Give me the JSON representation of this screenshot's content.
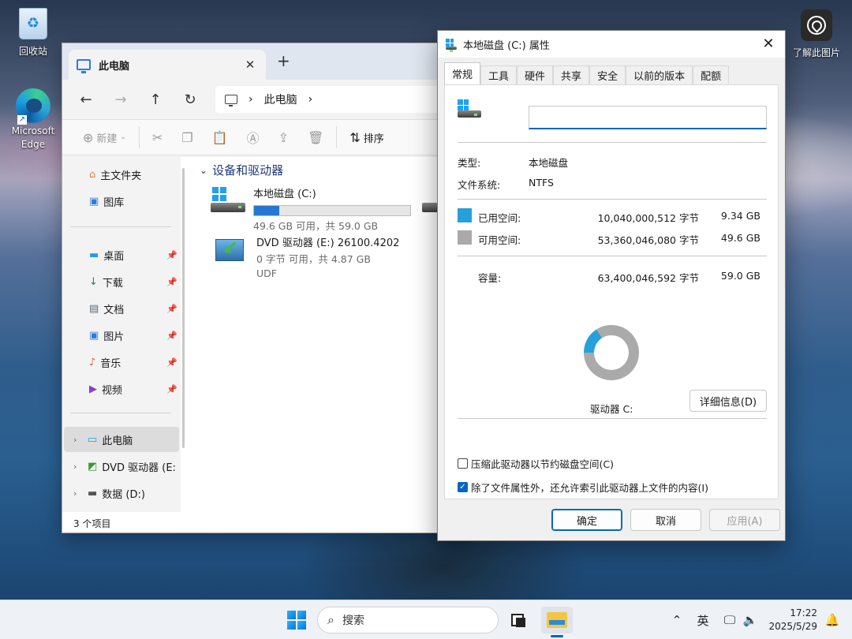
{
  "desktop": {
    "recycle_bin": "回收站",
    "edge": "Microsoft Edge",
    "about_pic": "了解此图片"
  },
  "explorer": {
    "tab_title": "此电脑",
    "tab_close": "✕",
    "new_tab": "+",
    "nav": {
      "back": "←",
      "forward": "→",
      "up": "↑",
      "refresh": "↻"
    },
    "breadcrumb": [
      "此电脑"
    ],
    "toolbar": {
      "new": "新建",
      "sort": "排序"
    },
    "quick_access": [
      {
        "label": "主文件夹",
        "icon": "home-icon"
      },
      {
        "label": "图库",
        "icon": "gallery-icon"
      }
    ],
    "pinned": [
      {
        "label": "桌面",
        "icon": "desktop-icon"
      },
      {
        "label": "下载",
        "icon": "download-icon"
      },
      {
        "label": "文档",
        "icon": "document-icon"
      },
      {
        "label": "图片",
        "icon": "pictures-icon"
      },
      {
        "label": "音乐",
        "icon": "music-icon"
      },
      {
        "label": "视频",
        "icon": "video-icon"
      }
    ],
    "tree": [
      {
        "label": "此电脑"
      },
      {
        "label": "DVD 驱动器 (E:"
      },
      {
        "label": "数据 (D:)"
      }
    ],
    "group_title": "设备和驱动器",
    "drives": [
      {
        "name": "本地磁盘 (C:)",
        "detail": "49.6 GB 可用，共 59.0 GB",
        "used_fraction": 0.16
      },
      {
        "name": "DVD 驱动器 (E:) 26100.4202",
        "detail": "0 字节 可用，共 4.87 GB",
        "fs": "UDF"
      }
    ],
    "status": "3 个项目"
  },
  "dialog": {
    "title": "本地磁盘 (C:) 属性",
    "close": "✕",
    "tabs": [
      "常规",
      "工具",
      "硬件",
      "共享",
      "安全",
      "以前的版本",
      "配额"
    ],
    "name_value": "",
    "type_label": "类型:",
    "type_value": "本地磁盘",
    "fs_label": "文件系统:",
    "fs_value": "NTFS",
    "used": {
      "label": "已用空间:",
      "bytes": "10,040,000,512 字节",
      "size": "9.34 GB",
      "color": "#26a0da"
    },
    "free": {
      "label": "可用空间:",
      "bytes": "53,360,046,080 字节",
      "size": "49.6 GB",
      "color": "#aaaaaa"
    },
    "capacity": {
      "label": "容量:",
      "bytes": "63,400,046,592 字节",
      "size": "59.0 GB"
    },
    "used_fraction": 0.158,
    "drive_label": "驱动器 C:",
    "details_button": "详细信息(D)",
    "compress_label": "压缩此驱动器以节约磁盘空间(C)",
    "compress_checked": false,
    "index_label": "除了文件属性外，还允许索引此驱动器上文件的内容(I)",
    "index_checked": true,
    "ok": "确定",
    "cancel": "取消",
    "apply": "应用(A)"
  },
  "taskbar": {
    "search_placeholder": "搜索",
    "ime": "英",
    "time": "17:22",
    "date": "2025/5/29"
  }
}
